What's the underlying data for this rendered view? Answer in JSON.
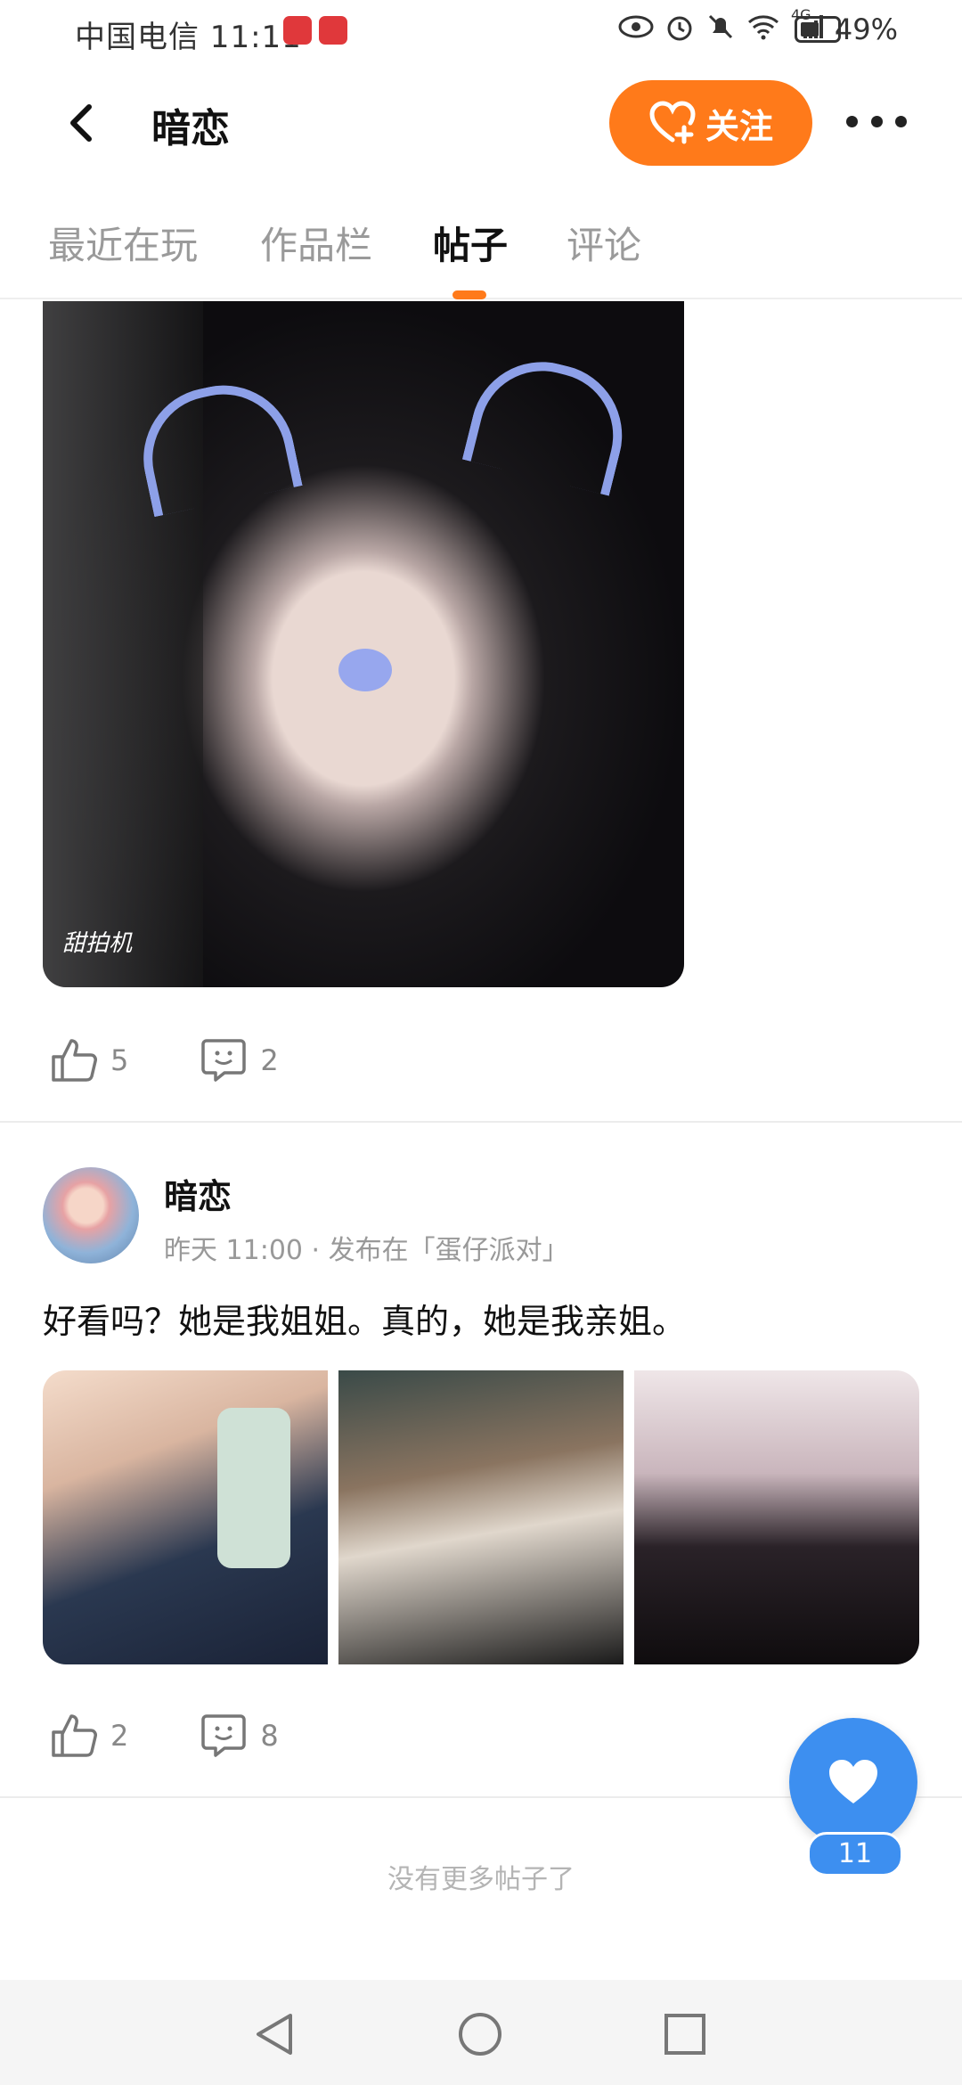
{
  "status_bar": {
    "carrier_time": "中国电信 11:11",
    "network": "4G",
    "battery": "49%"
  },
  "header": {
    "title": "暗恋",
    "follow_label": "关注"
  },
  "tabs": [
    "最近在玩",
    "作品栏",
    "帖子",
    "评论"
  ],
  "active_tab": "帖子",
  "post1": {
    "watermark": "甜拍机",
    "likes": "5",
    "comments": "2"
  },
  "post2": {
    "author": "暗恋",
    "meta": "昨天 11:00 · 发布在「蛋仔派对」",
    "text": "好看吗？她是我姐姐。真的，她是我亲姐。",
    "likes": "2",
    "comments": "8"
  },
  "float_like": {
    "count": "11"
  },
  "footer": {
    "end_text": "没有更多帖子了"
  },
  "colors": {
    "accent": "#ff7a1a",
    "like_blue": "#3d8ff0"
  },
  "icons": [
    "back-icon",
    "heart-plus-icon",
    "more-icon",
    "thumb-up-icon",
    "comment-icon",
    "heart-icon",
    "nav-back-icon",
    "nav-home-icon",
    "nav-recents-icon"
  ]
}
